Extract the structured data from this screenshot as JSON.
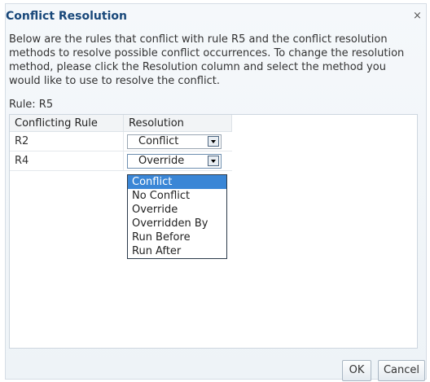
{
  "dialog": {
    "title": "Conflict Resolution",
    "close": "×",
    "description": "Below are the rules that conflict with rule R5 and the conflict resolution methods to resolve possible conflict occurrences. To change the resolution method, please click the Resolution column and select the method you would like to use to resolve the conflict.",
    "rule_label": "Rule: R5"
  },
  "table": {
    "columns": [
      "Conflicting Rule",
      "Resolution"
    ],
    "rows": [
      {
        "rule": "R2",
        "resolution": "Conflict"
      },
      {
        "rule": "R4",
        "resolution": "Override"
      }
    ]
  },
  "dropdown": {
    "options": [
      "Conflict",
      "No Conflict",
      "Override",
      "Overridden By",
      "Run Before",
      "Run After"
    ],
    "highlighted": "Conflict"
  },
  "buttons": {
    "ok": "OK",
    "cancel": "Cancel"
  }
}
